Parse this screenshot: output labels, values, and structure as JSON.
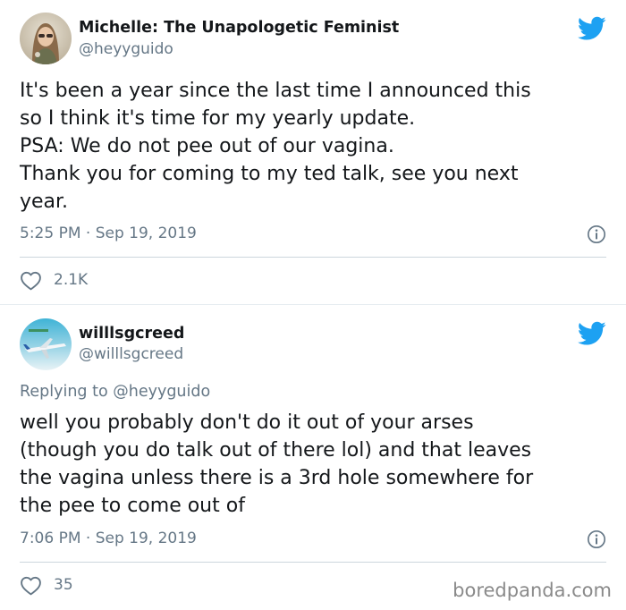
{
  "tweets": [
    {
      "author_name": "Michelle: The Unapologetic Feminist",
      "handle": "@heyyguido",
      "text_lines": [
        "It's been a year since the last time I announced this",
        "so I think it's time for my yearly update.",
        "PSA: We do not pee out of our vagina.",
        "Thank you for coming to my ted talk, see you next",
        "year."
      ],
      "timestamp": "5:25 PM · Sep 19, 2019",
      "like_count": "2.1K"
    },
    {
      "author_name": "willlsgcreed",
      "handle": "@willlsgcreed",
      "replying_prefix": "Replying to",
      "replying_to": "@heyyguido",
      "text_lines": [
        "well you probably don't do it out of your arses",
        "(though you do talk out of there lol) and that leaves",
        "the vagina unless there is a 3rd hole somewhere for",
        "the pee to come out of"
      ],
      "timestamp": "7:06 PM · Sep 19, 2019",
      "like_count": "35"
    }
  ],
  "watermark": "boredpanda.com",
  "colors": {
    "twitter_blue": "#1da1f2",
    "text_primary": "#14171a",
    "text_secondary": "#657786",
    "divider": "#ccd6dd"
  },
  "icons": {
    "brand": "twitter-bird-icon",
    "info": "info-icon",
    "like": "heart-icon"
  }
}
